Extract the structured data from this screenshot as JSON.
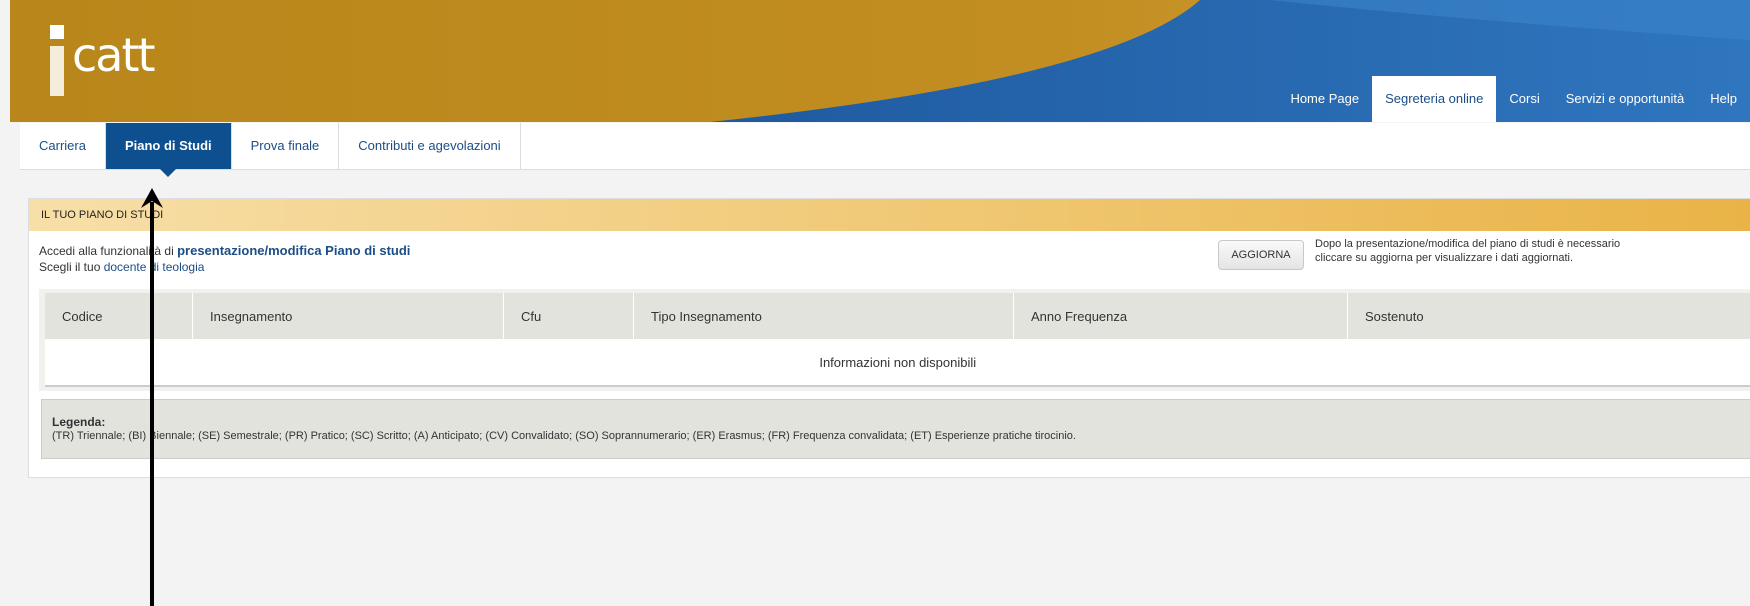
{
  "colors": {
    "gold": "#b8861a",
    "blue": "#0e4f8f",
    "link": "#1c4d86"
  },
  "logo": {
    "text": "catt"
  },
  "topnav": [
    {
      "label": "Home Page",
      "active": false
    },
    {
      "label": "Segreteria online",
      "active": true
    },
    {
      "label": "Corsi",
      "active": false
    },
    {
      "label": "Servizi e opportunità",
      "active": false
    },
    {
      "label": "Help",
      "active": false
    }
  ],
  "tabs": [
    {
      "label": "Carriera",
      "active": false
    },
    {
      "label": "Piano di Studi",
      "active": true
    },
    {
      "label": "Prova finale",
      "active": false
    },
    {
      "label": "Contributi e agevolazioni",
      "active": false
    }
  ],
  "panel": {
    "title": "Il tuo piano di studi",
    "intro_prefix": "Accedi alla funzionalità di ",
    "intro_link": "presentazione/modifica Piano di studi",
    "docente_prefix": "Scegli il tuo ",
    "docente_link": "docente di teologia",
    "update_button": "AGGIORNA",
    "note_line1": "Dopo la presentazione/modifica del piano di studi è necessario",
    "note_line2": "cliccare su aggiorna per visualizzare i dati aggiornati."
  },
  "table": {
    "columns": [
      "Codice",
      "Insegnamento",
      "Cfu",
      "Tipo Insegnamento",
      "Anno Frequenza",
      "Sostenuto"
    ],
    "empty_message": "Informazioni non disponibili"
  },
  "legend": {
    "title": "Legenda:",
    "text": "(TR) Triennale; (BI) Biennale; (SE) Semestrale; (PR) Pratico; (SC) Scritto; (A) Anticipato; (CV) Convalidato; (SO) Soprannumerario; (ER) Erasmus; (FR) Frequenza convalidata; (ET) Esperienze pratiche tirocinio."
  },
  "annotation": {
    "arrow_icon": "up-arrow-icon"
  }
}
